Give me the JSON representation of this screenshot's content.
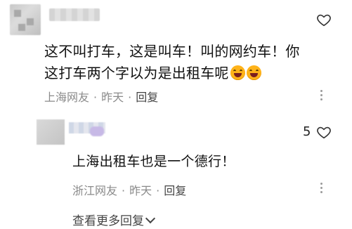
{
  "comment": {
    "text_line1": "这不叫打车，这是叫车！叫的网约车！你",
    "text_line2": "这打车两个字以为是出租车呢",
    "emoji_icon": "grinning-face-emoji",
    "location": "上海网友",
    "time": "昨天",
    "reply_label": "回复",
    "separator": "·"
  },
  "reply": {
    "likes": "5",
    "text": "上海出租车也是一个德行！",
    "location": "浙江网友",
    "time": "昨天",
    "reply_label": "回复",
    "separator": "·"
  },
  "footer": {
    "view_more": "查看更多回复"
  }
}
